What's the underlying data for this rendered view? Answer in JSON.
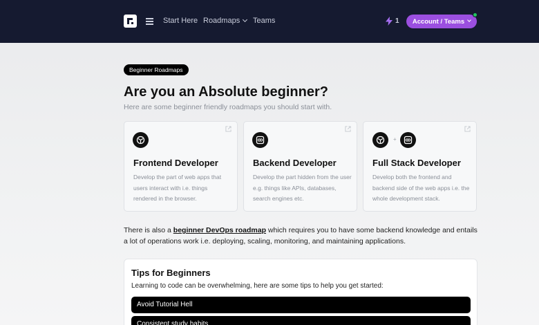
{
  "nav": {
    "links": [
      {
        "label": "Start Here",
        "has_dropdown": false
      },
      {
        "label": "Roadmaps",
        "has_dropdown": true
      },
      {
        "label": "Teams",
        "has_dropdown": false
      }
    ],
    "streak_count": "1",
    "account_label": "Account / Teams",
    "accent_color": "#9b4fe0",
    "online_color": "#22c55e"
  },
  "main": {
    "badge": "Beginner Roadmaps",
    "title": "Are you an Absolute beginner?",
    "subtitle": "Here are some beginner friendly roadmaps you should start with.",
    "cards": [
      {
        "title": "Frontend Developer",
        "description": "Develop the part of web apps that users interact with i.e. things rendered in the browser.",
        "icons": [
          "browser-icon"
        ]
      },
      {
        "title": "Backend Developer",
        "description": "Develop the part hidden from the user e.g. things like APIs, databases, search engines etc.",
        "icons": [
          "server-icon"
        ]
      },
      {
        "title": "Full Stack Developer",
        "description": "Develop both the frontend and backend side of the web apps i.e. the whole development stack.",
        "icons": [
          "browser-icon",
          "server-icon"
        ],
        "joiner": "+"
      }
    ],
    "devops": {
      "prefix": "There is also a ",
      "link": "beginner DevOps roadmap",
      "suffix": " which requires you to have some backend knowledge and entails a lot of operations work i.e. deploying, scaling, monitoring, and maintaining applications."
    }
  },
  "tips": {
    "title": "Tips for Beginners",
    "subtitle": "Learning to code can be overwhelming, here are some tips to help you get started:",
    "items": [
      "Avoid Tutorial Hell",
      "Consistent study habits"
    ]
  }
}
